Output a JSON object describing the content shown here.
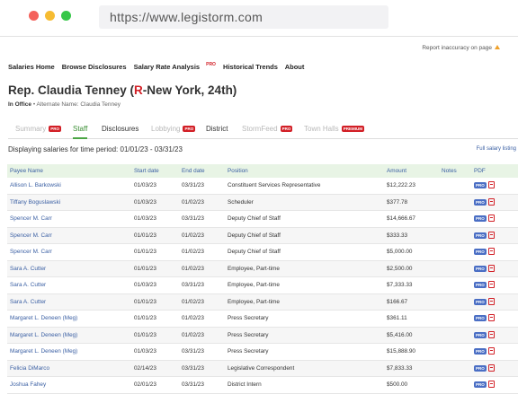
{
  "browser": {
    "url": "https://www.legistorm.com",
    "colors": {
      "close": "#f4615b",
      "minimize": "#f6bc32",
      "maximize": "#37c749"
    }
  },
  "report_link": "Report inaccuracy on page",
  "nav": {
    "items": [
      "Salaries Home",
      "Browse Disclosures",
      "Salary Rate Analysis",
      "Historical Trends",
      "About"
    ],
    "pro_badge": "PRO"
  },
  "member": {
    "prefix": "Rep. Claudia Tenney (",
    "party": "R",
    "suffix": "-New York, 24th)",
    "status": "In Office",
    "alt_name_label": " • Alternate Name: ",
    "alt_name": "Claudia Tenney"
  },
  "tabs": [
    {
      "label": "Summary",
      "badge": "PRO",
      "state": "disabled"
    },
    {
      "label": "Staff",
      "badge": "",
      "state": "active"
    },
    {
      "label": "Disclosures",
      "badge": "",
      "state": "normal"
    },
    {
      "label": "Lobbying",
      "badge": "PRO",
      "state": "disabled"
    },
    {
      "label": "District",
      "badge": "",
      "state": "normal"
    },
    {
      "label": "StormFeed",
      "badge": "PRO",
      "state": "disabled"
    },
    {
      "label": "Town Halls",
      "badge": "PREMIUM",
      "state": "disabled"
    }
  ],
  "period_text": "Displaying salaries for time period: 01/01/23 - 03/31/23",
  "full_listing": "Full salary listing",
  "table": {
    "headers": [
      "Payee Name",
      "Start date",
      "End date",
      "Position",
      "Amount",
      "Notes",
      "PDF"
    ],
    "pro_label": "PRO",
    "rows": [
      [
        "Allison L. Barkowski",
        "01/03/23",
        "03/31/23",
        "Constituent Services Representative",
        "$12,222.23"
      ],
      [
        "Tiffany Boguslawski",
        "01/03/23",
        "01/02/23",
        "Scheduler",
        "$377.78"
      ],
      [
        "Spencer M. Carr",
        "01/03/23",
        "03/31/23",
        "Deputy Chief of Staff",
        "$14,666.67"
      ],
      [
        "Spencer M. Carr",
        "01/01/23",
        "01/02/23",
        "Deputy Chief of Staff",
        "$333.33"
      ],
      [
        "Spencer M. Carr",
        "01/01/23",
        "01/02/23",
        "Deputy Chief of Staff",
        "$5,000.00"
      ],
      [
        "Sara A. Cutter",
        "01/01/23",
        "01/02/23",
        "Employee, Part-time",
        "$2,500.00"
      ],
      [
        "Sara A. Cutter",
        "01/03/23",
        "03/31/23",
        "Employee, Part-time",
        "$7,333.33"
      ],
      [
        "Sara A. Cutter",
        "01/01/23",
        "01/02/23",
        "Employee, Part-time",
        "$166.67"
      ],
      [
        "Margaret L. Deneen (Meg)",
        "01/01/23",
        "01/02/23",
        "Press Secretary",
        "$361.11"
      ],
      [
        "Margaret L. Deneen (Meg)",
        "01/01/23",
        "01/02/23",
        "Press Secretary",
        "$5,416.00"
      ],
      [
        "Margaret L. Deneen (Meg)",
        "01/03/23",
        "03/31/23",
        "Press Secretary",
        "$15,888.90"
      ],
      [
        "Felicia DiMarco",
        "02/14/23",
        "03/31/23",
        "Legislative Correspondent",
        "$7,833.33"
      ],
      [
        "Joshua Fahey",
        "02/01/23",
        "03/31/23",
        "District Intern",
        "$500.00"
      ]
    ]
  }
}
